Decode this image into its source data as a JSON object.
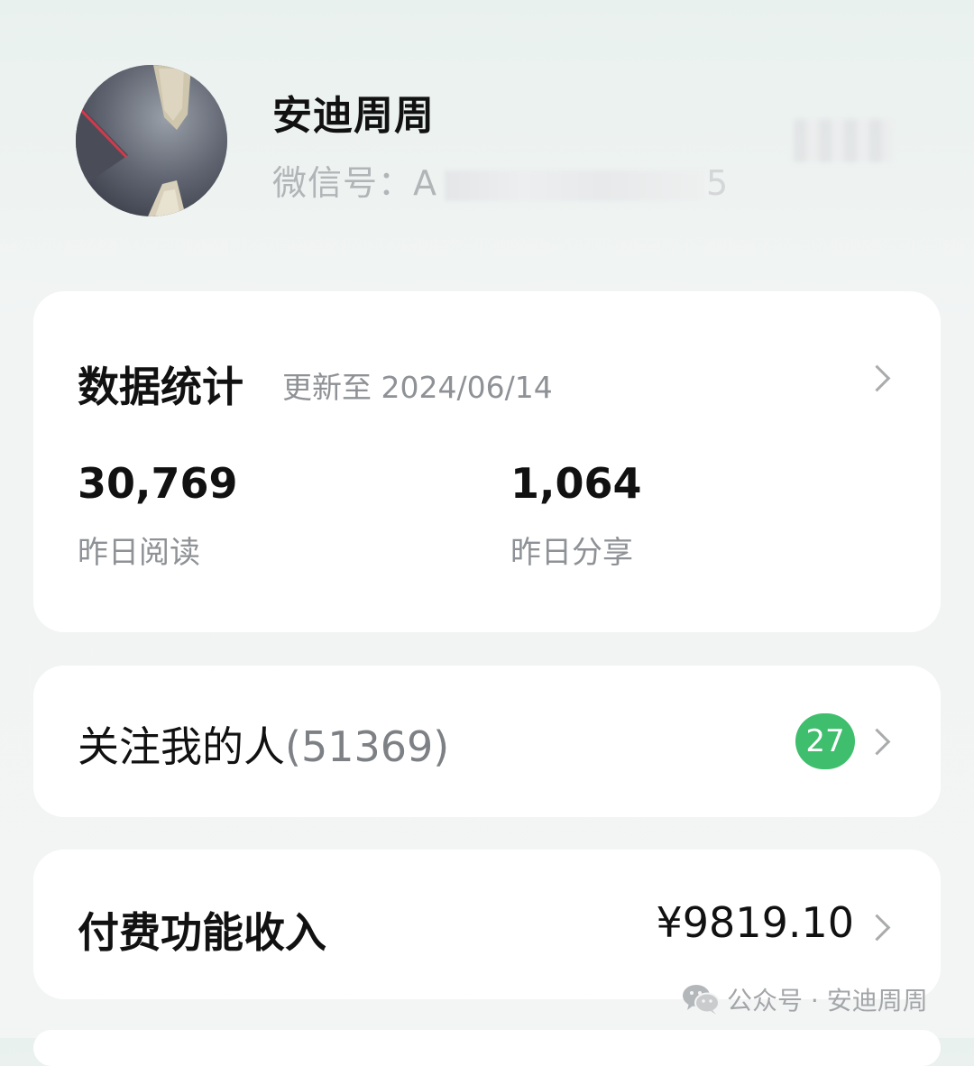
{
  "profile": {
    "name": "安迪周周",
    "wechat_label": "微信号：A",
    "wechat_suffix": "5"
  },
  "stats": {
    "title": "数据统计",
    "updated": "更新至 2024/06/14",
    "yesterday_reads_value": "30,769",
    "yesterday_reads_label": "昨日阅读",
    "yesterday_shares_value": "1,064",
    "yesterday_shares_label": "昨日分享"
  },
  "followers": {
    "label": "关注我的人",
    "count": "(51369)",
    "badge": "27"
  },
  "income": {
    "label": "付费功能收入",
    "value": "¥9819.10"
  },
  "watermark": {
    "text": "公众号 · 安迪周周"
  },
  "colors": {
    "accent_green": "#3fbe6d",
    "card_bg": "#ffffff",
    "muted_text": "#8e9195"
  }
}
